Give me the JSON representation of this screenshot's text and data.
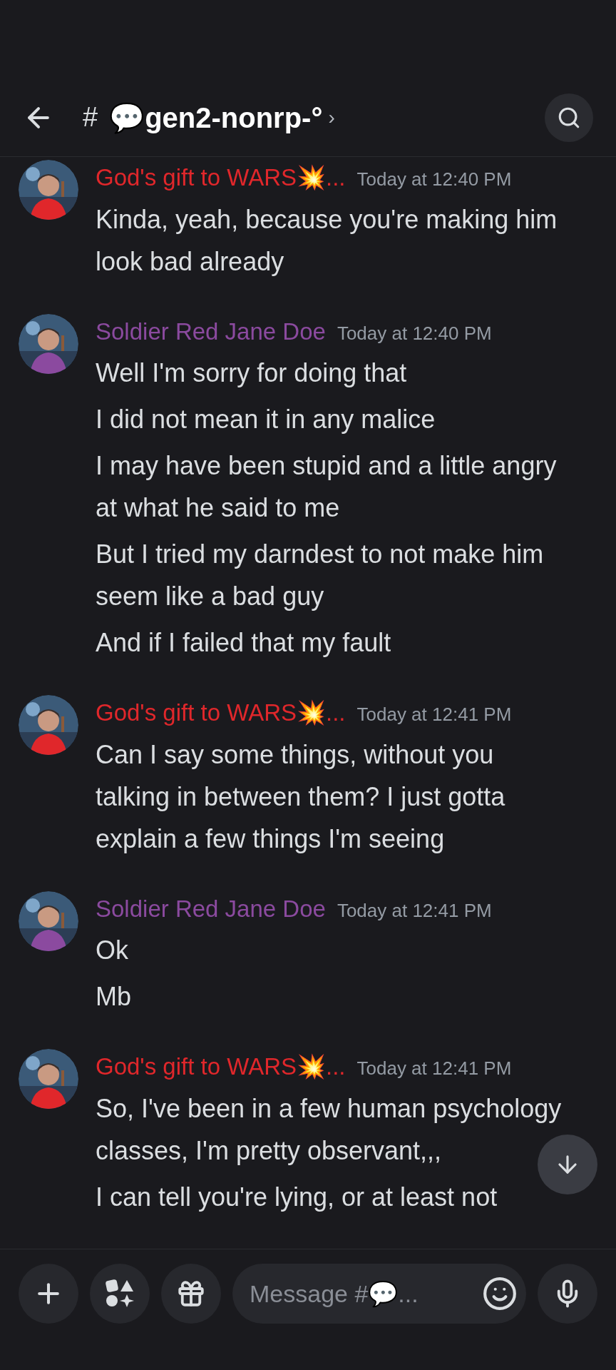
{
  "header": {
    "hash": "#",
    "channel": "💬gen2-nonrp-°",
    "chevron": "›"
  },
  "messages": [
    {
      "author": "God's gift to WARS💥...",
      "color": "#e0272b",
      "time": "Today at 12:40 PM",
      "lines": [
        "Kinda, yeah, because you're making him look bad already"
      ]
    },
    {
      "author": "Soldier Red Jane Doe",
      "color": "#8b4a9f",
      "time": "Today at 12:40 PM",
      "lines": [
        "Well I'm sorry for doing that",
        "I did not mean it in any malice",
        "I may have been stupid and a little angry at what he said to me",
        "But I tried my darndest to not make him seem like a bad guy",
        "And if I failed that my fault"
      ]
    },
    {
      "author": "God's gift to WARS💥...",
      "color": "#e0272b",
      "time": "Today at 12:41 PM",
      "lines": [
        "Can I say some things, without you talking in between them? I just gotta explain a few things I'm seeing"
      ]
    },
    {
      "author": "Soldier Red Jane Doe",
      "color": "#8b4a9f",
      "time": "Today at 12:41 PM",
      "lines": [
        "Ok",
        "Mb"
      ]
    },
    {
      "author": "God's gift to WARS💥...",
      "color": "#e0272b",
      "time": "Today at 12:41 PM",
      "lines": [
        "So, I've been in a few human psychology classes, I'm pretty observant,,,",
        "I can tell you're lying, or at least not"
      ]
    }
  ],
  "composer": {
    "placeholder": "Message #💬..."
  }
}
